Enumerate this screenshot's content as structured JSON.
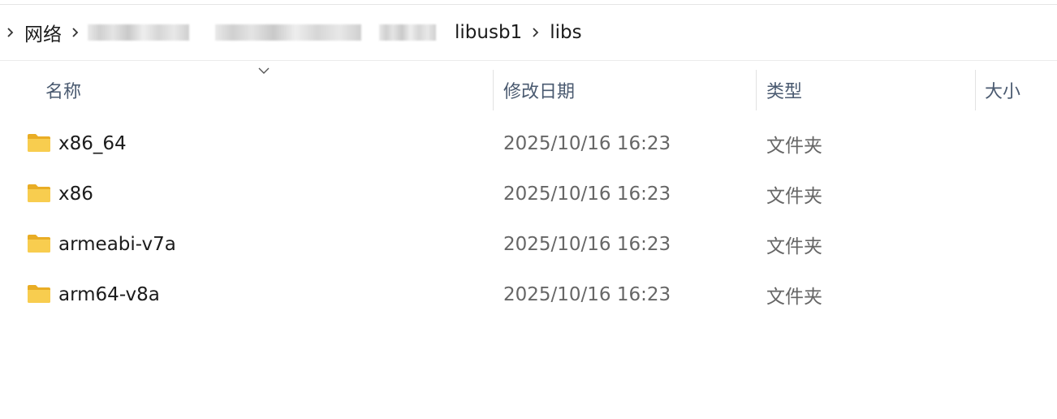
{
  "breadcrumb": {
    "items": [
      {
        "label": "网络"
      },
      {
        "label": ""
      },
      {
        "label": "libusb1"
      },
      {
        "label": "libs"
      }
    ]
  },
  "columns": {
    "name": "名称",
    "modified": "修改日期",
    "type": "类型",
    "size": "大小"
  },
  "files": [
    {
      "name": "x86_64",
      "modified": "2025/10/16 16:23",
      "type": "文件夹",
      "icon": "folder-icon"
    },
    {
      "name": "x86",
      "modified": "2025/10/16 16:23",
      "type": "文件夹",
      "icon": "folder-icon"
    },
    {
      "name": "armeabi-v7a",
      "modified": "2025/10/16 16:23",
      "type": "文件夹",
      "icon": "folder-icon"
    },
    {
      "name": "arm64-v8a",
      "modified": "2025/10/16 16:23",
      "type": "文件夹",
      "icon": "folder-icon"
    }
  ],
  "colors": {
    "folder": "#f5c43c",
    "header_text": "#4a5a70",
    "secondary_text": "#666666"
  }
}
